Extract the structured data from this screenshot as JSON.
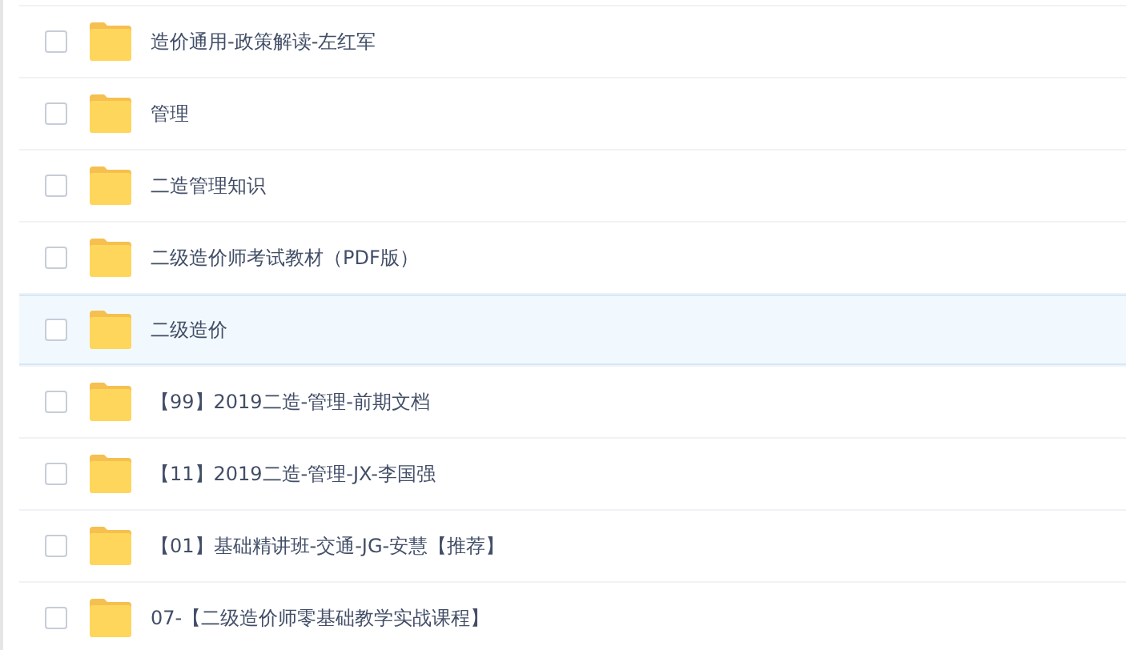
{
  "files": [
    {
      "name": "造价通用-政策解读-左红军",
      "checked": false,
      "highlighted": false
    },
    {
      "name": "管理",
      "checked": false,
      "highlighted": false
    },
    {
      "name": "二造管理知识",
      "checked": false,
      "highlighted": false
    },
    {
      "name": "二级造价师考试教材（PDF版）",
      "checked": false,
      "highlighted": false
    },
    {
      "name": "二级造价",
      "checked": false,
      "highlighted": true
    },
    {
      "name": "【99】2019二造-管理-前期文档",
      "checked": false,
      "highlighted": false
    },
    {
      "name": "【11】2019二造-管理-JX-李国强",
      "checked": false,
      "highlighted": false
    },
    {
      "name": "【01】基础精讲班-交通-JG-安慧【推荐】",
      "checked": false,
      "highlighted": false
    },
    {
      "name": "07-【二级造价师零基础教学实战课程】",
      "checked": false,
      "highlighted": false
    }
  ]
}
